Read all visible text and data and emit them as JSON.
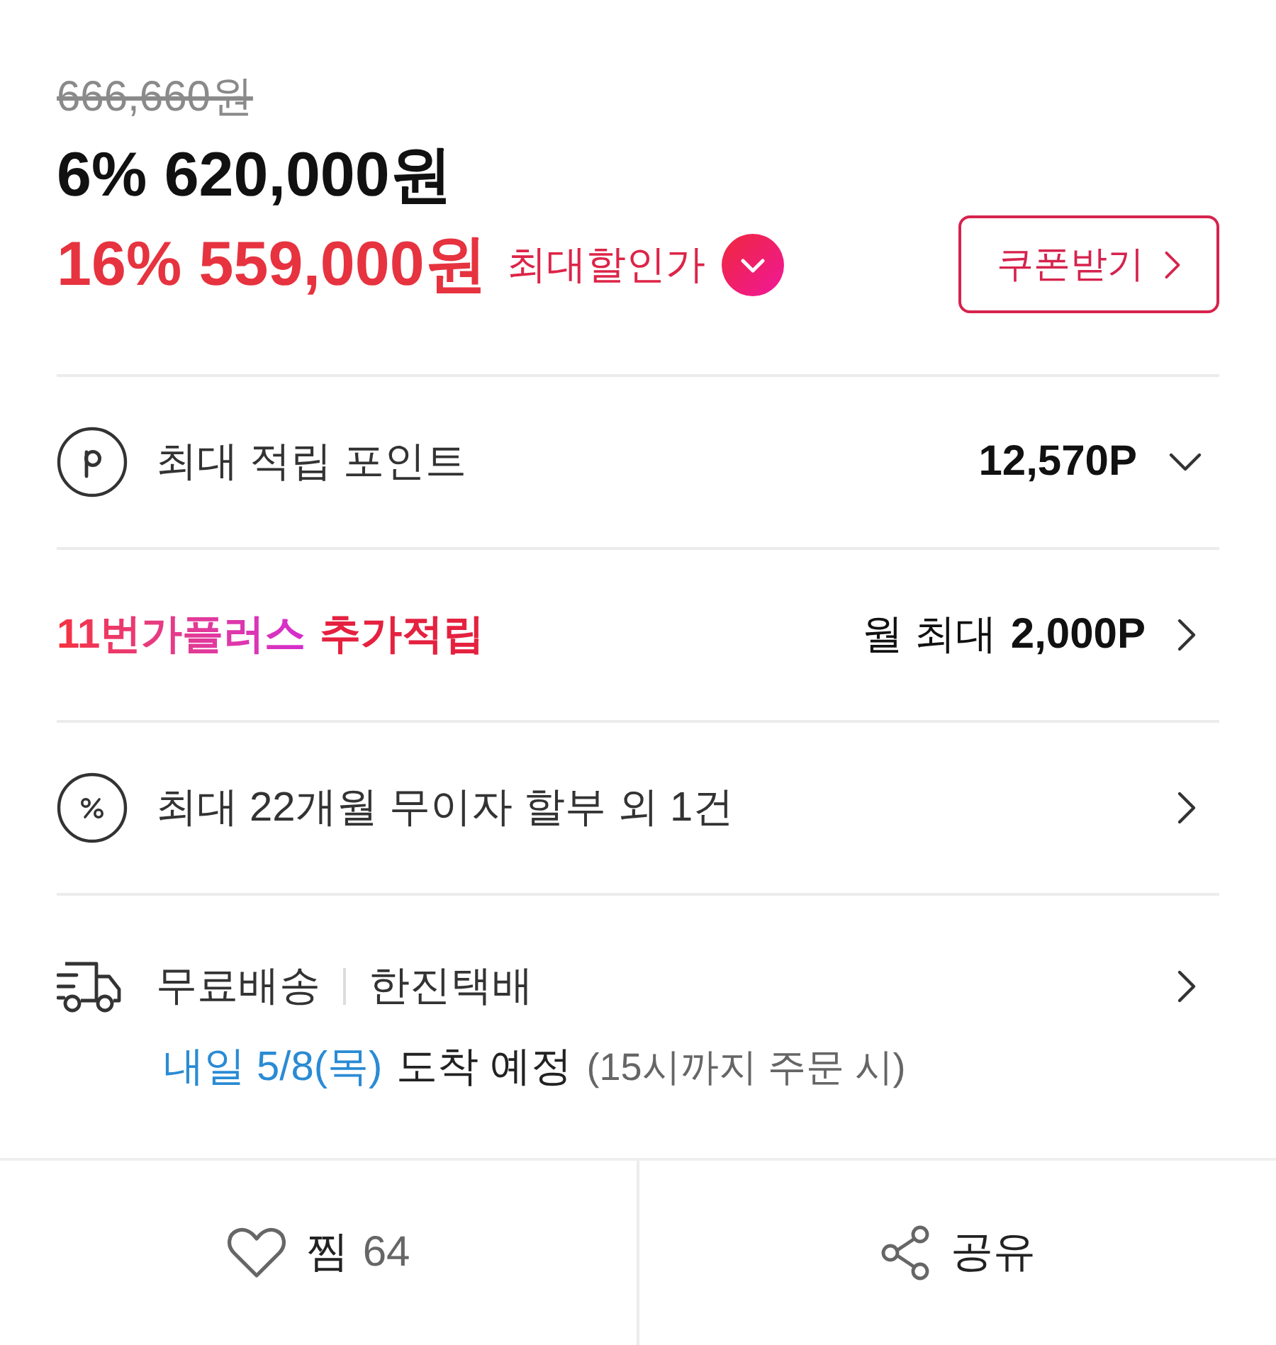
{
  "price": {
    "original": "666,660원",
    "sale": {
      "rate": "6%",
      "amount": "620,000원"
    },
    "max_discount": {
      "rate": "16%",
      "amount": "559,000원",
      "label": "최대할인가"
    },
    "coupon_button": "쿠폰받기"
  },
  "rows": [
    {
      "kind": "points",
      "label": "최대 적립 포인트",
      "value": "12,570P",
      "expanded": false
    },
    {
      "kind": "plus",
      "brand": "11번가플러스",
      "label": "추가적립",
      "prefix": "월 최대",
      "value": "2,000P"
    },
    {
      "kind": "installment",
      "label": "최대 22개월 무이자 할부 외 1건"
    },
    {
      "kind": "shipping",
      "label": "무료배송",
      "carrier": "한진택배",
      "arrival_date": "내일 5/8(목)",
      "arrival": "도착 예정",
      "note": "(15시까지 주문 시)"
    }
  ],
  "actions": [
    {
      "kind": "like",
      "label": "찜",
      "count": "64"
    },
    {
      "kind": "share",
      "label": "공유"
    }
  ]
}
